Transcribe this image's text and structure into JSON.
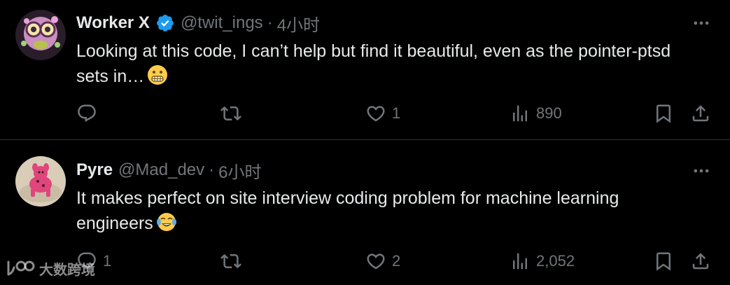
{
  "tweets": [
    {
      "display_name": "Worker X",
      "verified": true,
      "handle": "@twit_ings",
      "separator": "·",
      "time": "4小时",
      "text": "Looking at this code, I can’t help but find it beautiful, even as the pointer-ptsd sets in…",
      "emoji": "grimacing-face",
      "reply_count": "",
      "retweet_count": "",
      "like_count": "1",
      "view_count": "890"
    },
    {
      "display_name": "Pyre",
      "verified": false,
      "handle": "@Mad_dev",
      "separator": "·",
      "time": "6小时",
      "text": "It makes perfect on site interview coding problem for machine learning engineers",
      "emoji": "face-with-tears-of-joy",
      "reply_count": "1",
      "retweet_count": "",
      "like_count": "2",
      "view_count": "2,052"
    }
  ],
  "watermark": {
    "text": "大数跨境"
  },
  "colors": {
    "background": "#000000",
    "text_primary": "#e7e9ea",
    "text_secondary": "#71767b",
    "verified_blue": "#1d9bf0",
    "divider": "#2f3336"
  }
}
